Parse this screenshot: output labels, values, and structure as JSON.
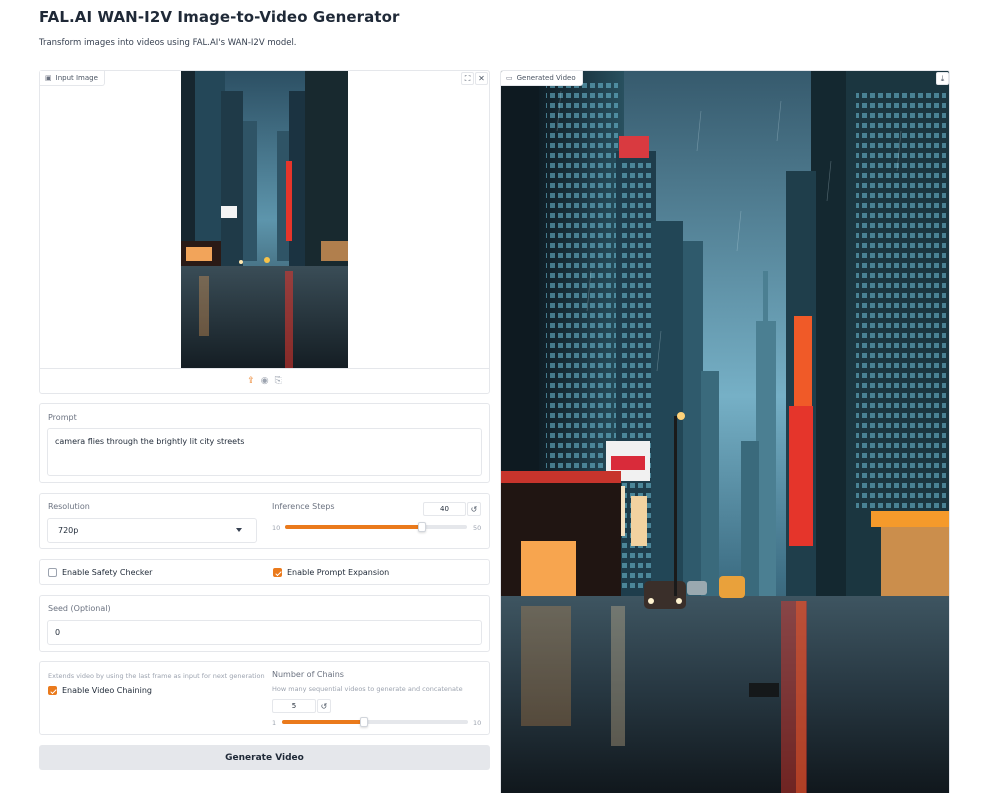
{
  "app": {
    "title": "FAL.AI WAN-I2V Image-to-Video Generator",
    "subtitle": "Transform images into videos using FAL.AI's WAN-I2V model."
  },
  "input_image": {
    "label": "Input Image",
    "icons": [
      "image-icon",
      "fullscreen-icon",
      "close-icon",
      "upload-icon",
      "webcam-icon",
      "clipboard-icon"
    ]
  },
  "prompt": {
    "label": "Prompt",
    "value": "camera flies through the brightly lit city streets"
  },
  "resolution": {
    "label": "Resolution",
    "selected": "720p"
  },
  "inference_steps": {
    "label": "Inference Steps",
    "value": "40",
    "min": "10",
    "max": "50",
    "fraction": 0.75
  },
  "options": {
    "safety_checker": {
      "label": "Enable Safety Checker",
      "checked": false
    },
    "prompt_expansion": {
      "label": "Enable Prompt Expansion",
      "checked": true
    }
  },
  "seed": {
    "label": "Seed (Optional)",
    "value": "0"
  },
  "chaining": {
    "hint": "Extends video by using the last frame as input for next generation",
    "label": "Enable Video Chaining",
    "checked": true
  },
  "chains": {
    "label": "Number of Chains",
    "hint": "How many sequential videos to generate and concatenate",
    "value": "5",
    "min": "1",
    "max": "10",
    "fraction": 0.44
  },
  "generate_button": {
    "label": "Generate Video"
  },
  "output_video": {
    "label": "Generated Video",
    "icons": [
      "video-icon",
      "download-icon"
    ]
  },
  "colors": {
    "accent": "#ea7a1c",
    "button_bg": "#e5e7eb"
  }
}
